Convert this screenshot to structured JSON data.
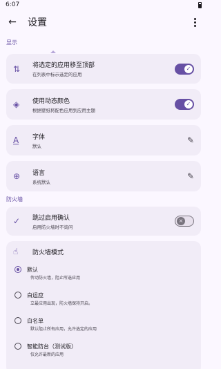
{
  "status": {
    "time": "6:07"
  },
  "appbar": {
    "title": "设置"
  },
  "display": {
    "label": "显示",
    "items": [
      {
        "title": "将选定的应用移至顶部",
        "subtitle": "在列表中标示选定的应用",
        "toggle": true
      },
      {
        "title": "使用动态颜色",
        "subtitle": "根据壁纸将配色应用到应用主题",
        "toggle": true
      },
      {
        "title": "字体",
        "subtitle": "默认"
      },
      {
        "title": "语言",
        "subtitle": "系统默认"
      }
    ]
  },
  "firewall": {
    "label": "防火墙",
    "skip": {
      "title": "跳过启用确认",
      "subtitle": "启用防火墙时不询问",
      "toggle": false
    },
    "mode": {
      "title": "防火墙模式",
      "options": [
        {
          "label": "默认",
          "desc": "传动防火墙，阻止所选应用",
          "checked": true
        },
        {
          "label": "白运应",
          "desc": "立最应用出现，防火墙保持开启。",
          "checked": false
        },
        {
          "label": "白名单",
          "desc": "默认阻止所有应用，允许选定的应用",
          "checked": false
        },
        {
          "label": "智能防台（测试版）",
          "desc": "仅允许最新的应用",
          "checked": false
        }
      ]
    }
  }
}
